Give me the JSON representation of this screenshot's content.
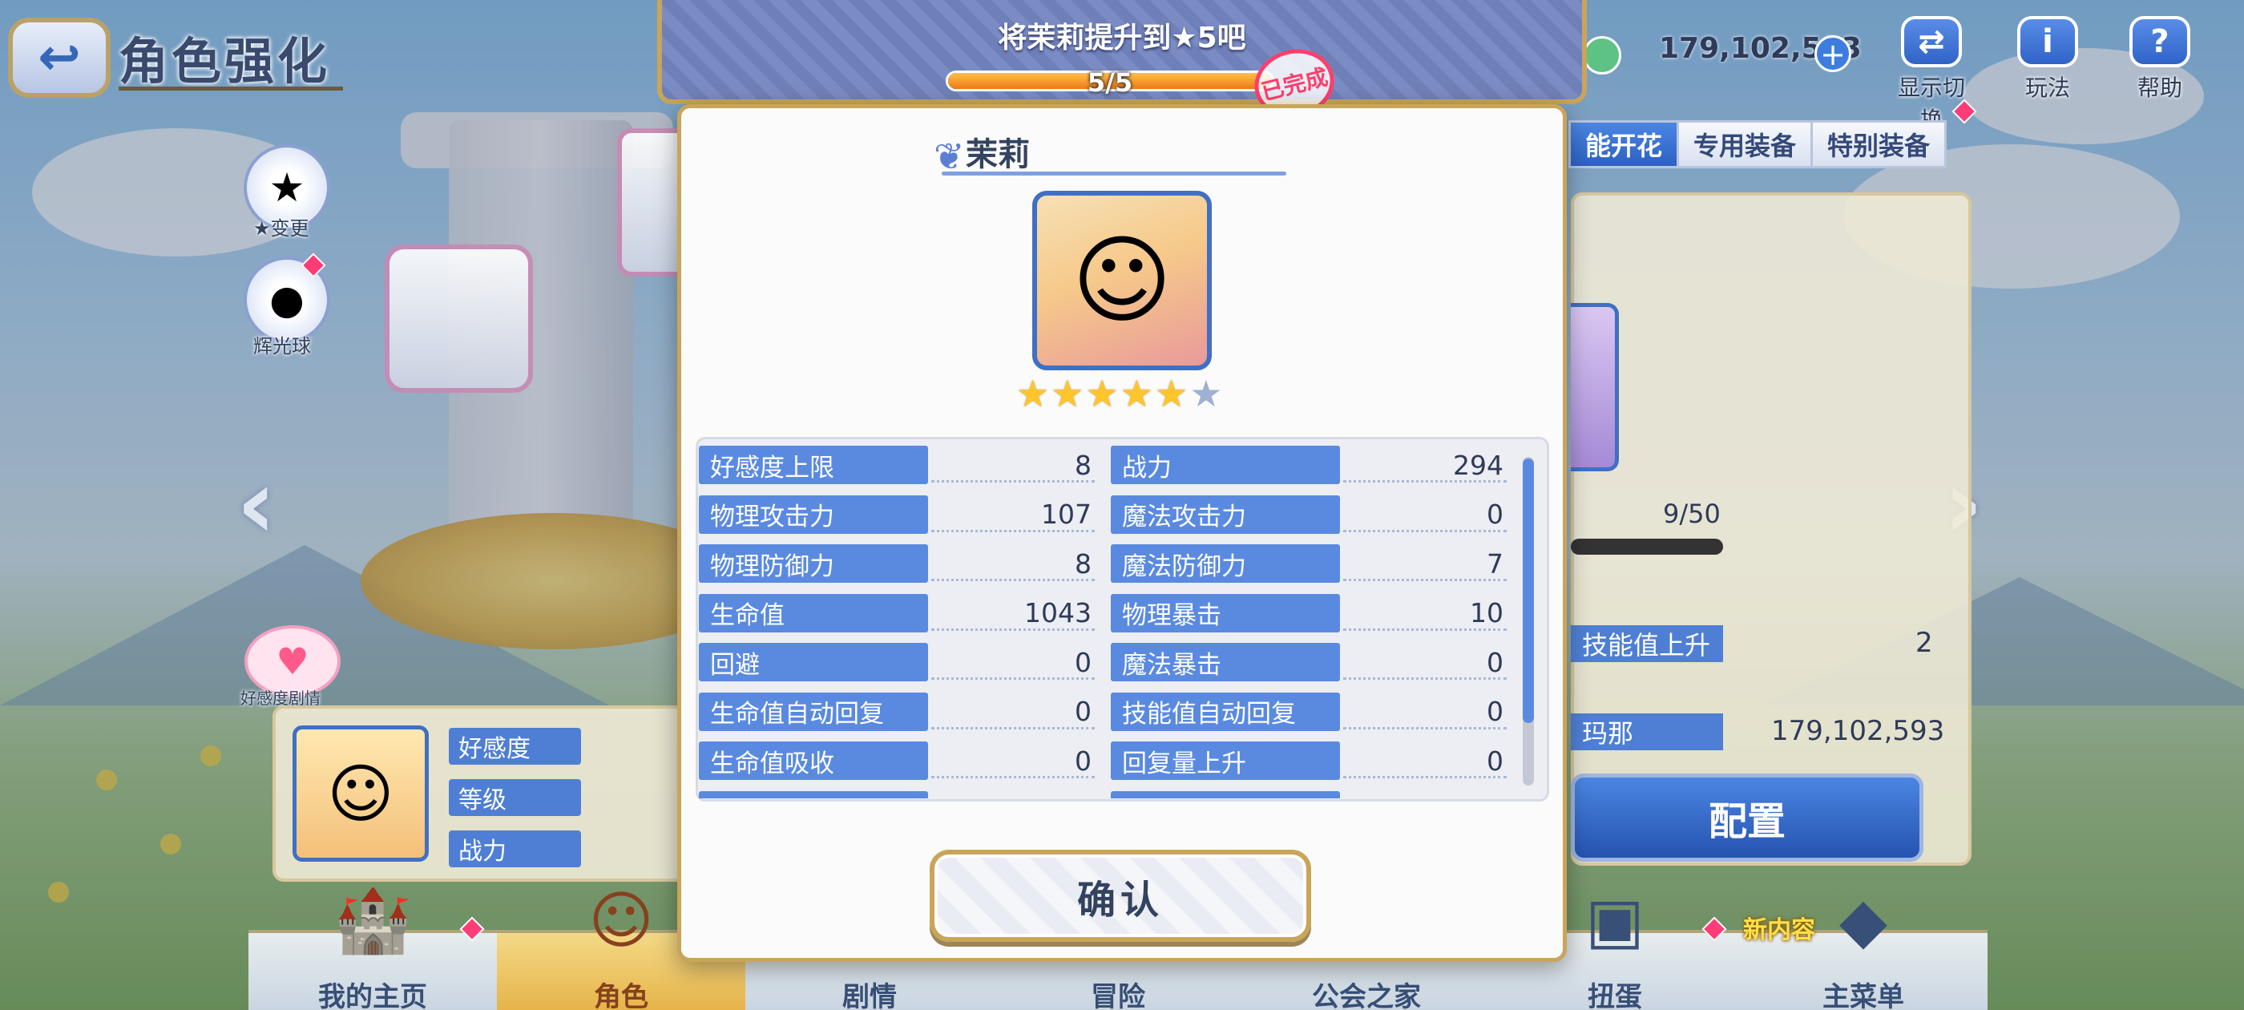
{
  "header": {
    "title": "角色强化"
  },
  "side_buttons": {
    "star_change": "★变更",
    "shine": "辉光球"
  },
  "currency": {
    "amount": "179,102,593"
  },
  "top_right": {
    "display_switch": "显示切换",
    "gameplay": "玩法",
    "help": "帮助"
  },
  "tabs": [
    "能开花",
    "专用装备",
    "特别装备"
  ],
  "right_panel": {
    "count": "9/50",
    "skill_label": "技能值上升",
    "skill_value": "2",
    "mana_label": "玛那",
    "mana_value": "179,102,593",
    "config_button": "配置"
  },
  "char_card": {
    "labels": [
      "好感度",
      "等级",
      "战力"
    ]
  },
  "love_bubble": "好感度剧情",
  "bottom_nav": [
    "我的主页",
    "角色",
    "剧情",
    "冒险",
    "公会之家",
    "扭蛋",
    "主菜单"
  ],
  "new_tag": "新内容",
  "modal": {
    "title": "将茉莉提升到★5吧",
    "progress_text": "5/5",
    "progress_fraction": 1.0,
    "stamp": "已完成",
    "character_name": "茉莉",
    "stars_filled": 5,
    "stars_total": 6,
    "stats": [
      {
        "label": "好感度上限",
        "value": "8"
      },
      {
        "label": "战力",
        "value": "294"
      },
      {
        "label": "物理攻击力",
        "value": "107"
      },
      {
        "label": "魔法攻击力",
        "value": "0"
      },
      {
        "label": "物理防御力",
        "value": "8"
      },
      {
        "label": "魔法防御力",
        "value": "7"
      },
      {
        "label": "生命值",
        "value": "1043"
      },
      {
        "label": "物理暴击",
        "value": "10"
      },
      {
        "label": "回避",
        "value": "0"
      },
      {
        "label": "魔法暴击",
        "value": "0"
      },
      {
        "label": "生命值自动回复",
        "value": "0"
      },
      {
        "label": "技能值自动回复",
        "value": "0"
      },
      {
        "label": "生命值吸收",
        "value": "0"
      },
      {
        "label": "回复量上升",
        "value": "0"
      }
    ],
    "confirm_label": "确认"
  },
  "colors": {
    "accent_blue": "#5a8ae0",
    "gold_border": "#c9a55a",
    "stamp_red": "#ff3e6c",
    "progress_orange": "#f07a16"
  }
}
